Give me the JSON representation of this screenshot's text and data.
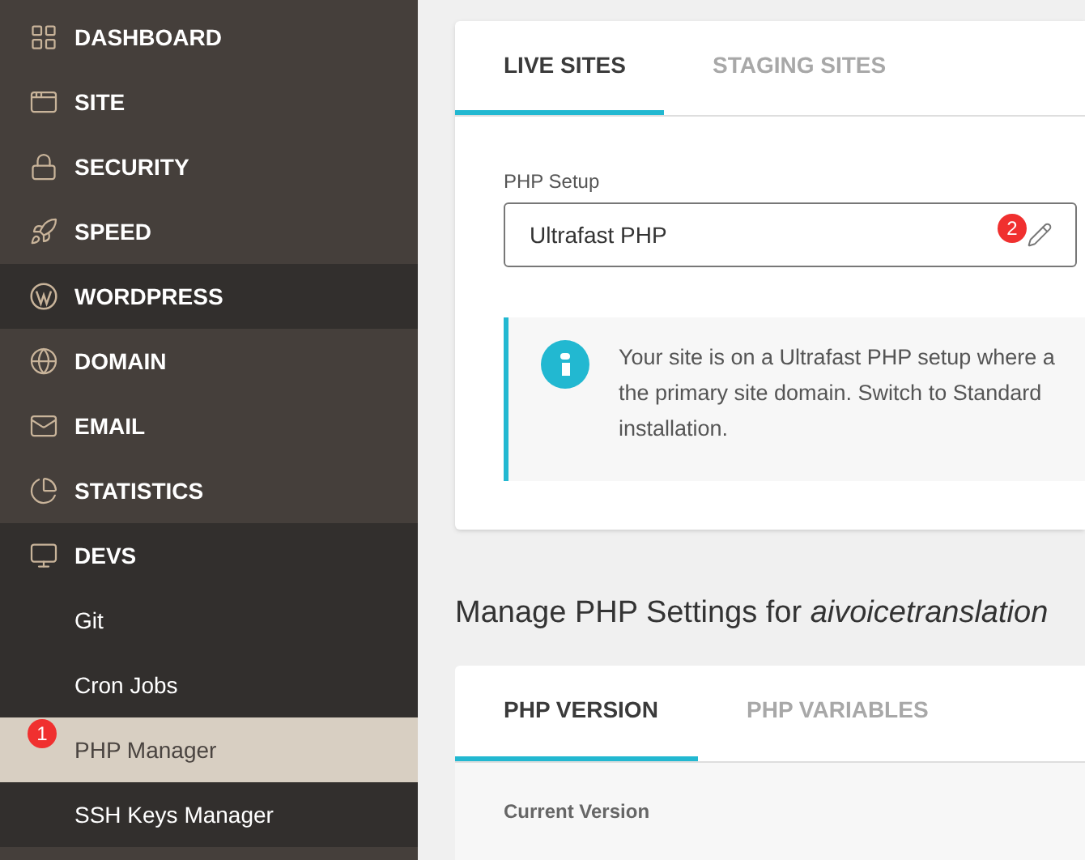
{
  "sidebar": {
    "items": [
      {
        "label": "DASHBOARD",
        "selected": false
      },
      {
        "label": "SITE",
        "selected": false
      },
      {
        "label": "SECURITY",
        "selected": false
      },
      {
        "label": "SPEED",
        "selected": false
      },
      {
        "label": "WORDPRESS",
        "selected": true
      },
      {
        "label": "DOMAIN",
        "selected": false
      },
      {
        "label": "EMAIL",
        "selected": false
      },
      {
        "label": "STATISTICS",
        "selected": false
      },
      {
        "label": "DEVS",
        "expanded": true,
        "children": [
          {
            "label": "Git",
            "selected": false
          },
          {
            "label": "Cron Jobs",
            "selected": false
          },
          {
            "label": "PHP Manager",
            "selected": true,
            "badge": "1"
          },
          {
            "label": "SSH Keys Manager",
            "selected": false
          }
        ]
      }
    ]
  },
  "site_card": {
    "tabs": [
      {
        "label": "LIVE SITES",
        "selected": true
      },
      {
        "label": "STAGING SITES",
        "selected": false
      }
    ],
    "php_setup": {
      "label": "PHP Setup",
      "value": "Ultrafast PHP",
      "badge": "2"
    },
    "notice": {
      "lines": [
        "Your site is on a Ultrafast PHP setup where a",
        "the primary site domain. Switch to Standard",
        "installation."
      ]
    }
  },
  "section_title": "Manage PHP Settings for *aivoicetranslation*",
  "php_card": {
    "tabs": [
      {
        "label": "PHP VERSION",
        "selected": true
      },
      {
        "label": "PHP VARIABLES",
        "selected": false
      }
    ],
    "column_header": "Current Version"
  }
}
